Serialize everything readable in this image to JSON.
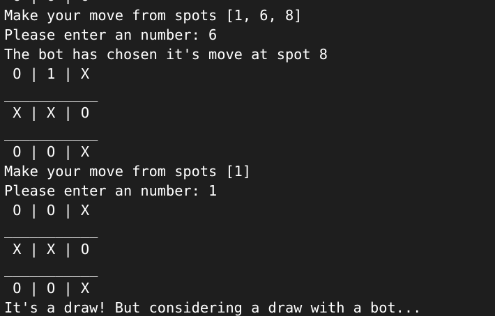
{
  "terminal": {
    "lines": [
      " O | O | O",
      "Make your move from spots [1, 6, 8]",
      "Please enter an number: 6",
      "The bot has chosen it's move at spot 8",
      " O | 1 | X",
      "___________",
      " X | X | O",
      "___________",
      " O | O | X",
      "Make your move from spots [1]",
      "Please enter an number: 1",
      " O | O | X",
      "___________",
      " X | X | O",
      "___________",
      " O | O | X",
      "It's a draw! But considering a draw with a bot..."
    ]
  },
  "colors": {
    "background": "#1e1e1e",
    "text": "#ffffff"
  }
}
